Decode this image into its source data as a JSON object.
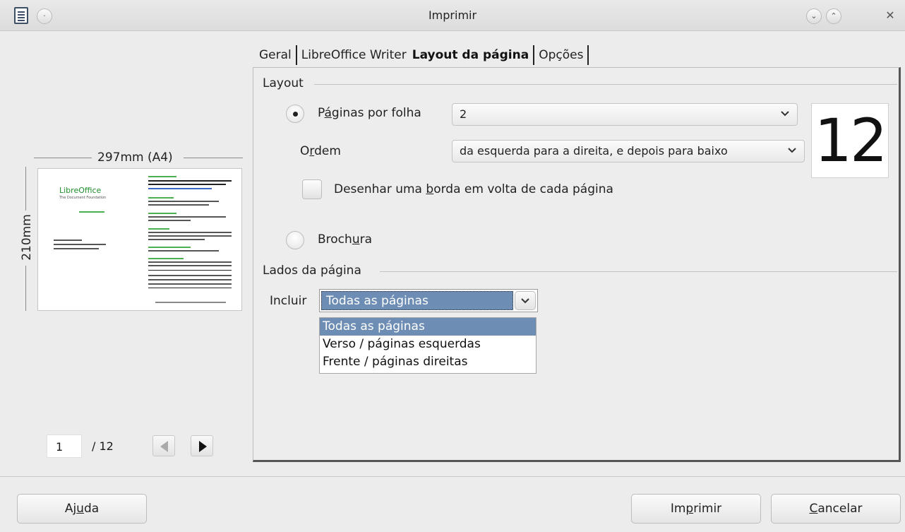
{
  "window": {
    "title": "Imprimir"
  },
  "preview": {
    "paper_size": "297mm (A4)",
    "paper_height": "210mm",
    "current_page": "1",
    "total_pages": "/ 12",
    "logo_text": "LibreOffice"
  },
  "tabs": [
    {
      "label": "Geral"
    },
    {
      "label": "LibreOffice Writer"
    },
    {
      "label": "Layout da página",
      "active": true
    },
    {
      "label": "Opções"
    }
  ],
  "layout": {
    "group_title": "Layout",
    "pages_per_sheet_label_pre": "P",
    "pages_per_sheet_label_ul": "á",
    "pages_per_sheet_label_post": "ginas por folha",
    "pages_per_sheet_value": "2",
    "order_label_pre": "O",
    "order_label_ul": "r",
    "order_label_post": "dem",
    "order_value": "da esquerda para a direita, e depois para baixo",
    "border_label_pre": "Desenhar uma ",
    "border_label_ul": "b",
    "border_label_post": "orda em volta de cada página",
    "border_checked": false,
    "brochure_label_pre": "Broch",
    "brochure_label_ul": "u",
    "brochure_label_post": "ra",
    "page_count_preview": "12"
  },
  "page_sides": {
    "group_title": "Lados da página",
    "include_label": "Incluir",
    "include_value": "Todas as páginas",
    "options": [
      "Todas as páginas",
      "Verso / páginas esquerdas",
      "Frente / páginas direitas"
    ]
  },
  "buttons": {
    "help_pre": "Aj",
    "help_ul": "u",
    "help_post": "da",
    "print_pre": "Im",
    "print_ul": "p",
    "print_post": "rimir",
    "cancel_pre": "",
    "cancel_ul": "C",
    "cancel_post": "ancelar"
  },
  "colors": {
    "selection": "#6d8db4",
    "background": "#ececec"
  }
}
